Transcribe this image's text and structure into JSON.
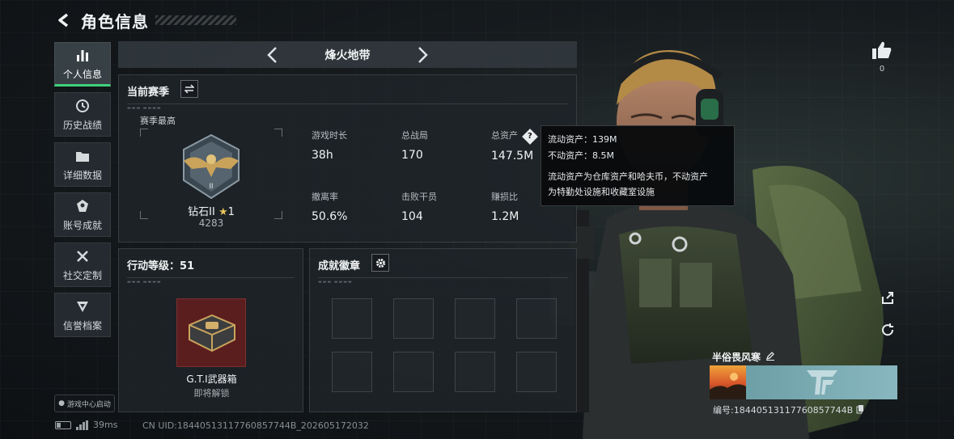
{
  "header": {
    "title": "角色信息"
  },
  "sidenav": {
    "items": [
      {
        "label": "个人信息",
        "icon": "bar-chart-icon",
        "active": true
      },
      {
        "label": "历史战绩",
        "icon": "clock-icon",
        "active": false
      },
      {
        "label": "详细数据",
        "icon": "folder-icon",
        "active": false
      },
      {
        "label": "账号成就",
        "icon": "achievement-icon",
        "active": false
      },
      {
        "label": "社交定制",
        "icon": "tools-icon",
        "active": false
      },
      {
        "label": "信誉档案",
        "icon": "shield-icon",
        "active": false
      }
    ],
    "launch_chip": "游戏中心启动"
  },
  "status": {
    "latency": "39ms",
    "uid": "CN UID:18440513117760857744B_202605172032"
  },
  "map_selector": {
    "name": "烽火地带"
  },
  "season": {
    "title": "当前赛季",
    "best_label": "赛季最高",
    "rank_name": "钻石II",
    "rank_stars": "1",
    "rank_points": "4283",
    "rank_emblem_numeral": "II",
    "stats": [
      {
        "label": "游戏时长",
        "value": "38h"
      },
      {
        "label": "总战局",
        "value": "170"
      },
      {
        "label": "总资产",
        "value": "147.5M"
      },
      {
        "label": "撤离率",
        "value": "50.6%"
      },
      {
        "label": "击败干员",
        "value": "104"
      },
      {
        "label": "赚损比",
        "value": "1.2M"
      }
    ]
  },
  "tooltip": {
    "line1": "流动资产：139M",
    "line2": "不动资产：8.5M",
    "desc1": "流动资产为仓库资产和哈夫币，不动资产",
    "desc2": "为特勤处设施和收藏室设施"
  },
  "action_level": {
    "title": "行动等级：51",
    "reward_name": "G.T.I武器箱",
    "reward_status": "即将解锁"
  },
  "badges": {
    "title": "成就徽章"
  },
  "player": {
    "likes": "0",
    "name": "半俗畏风寒",
    "id": "编号:18440513117760857744B"
  },
  "colors": {
    "accent": "#3fd17b",
    "banner": "#7aaab2"
  }
}
